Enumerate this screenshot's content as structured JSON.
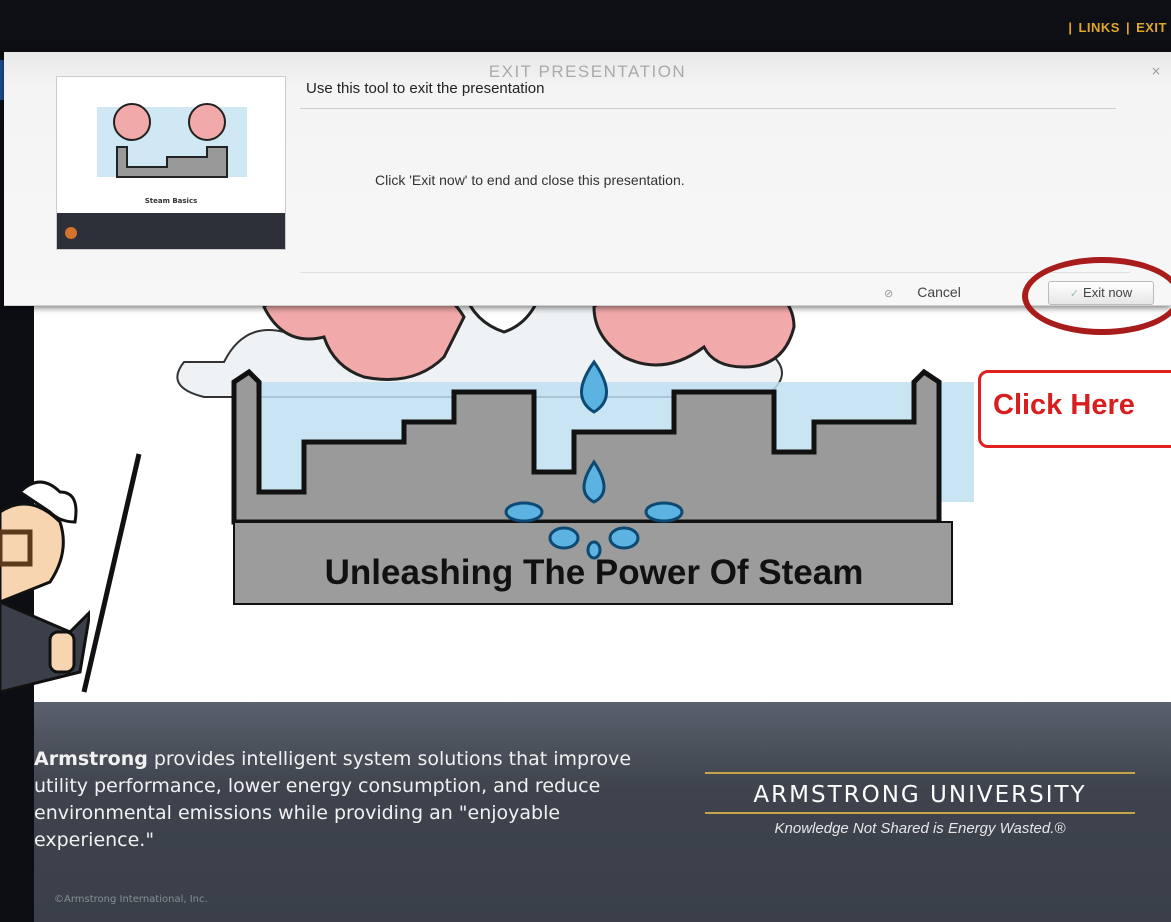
{
  "topbar": {
    "links_label": "LINKS",
    "exit_label": "EXIT"
  },
  "dialog": {
    "title": "EXIT PRESENTATION",
    "close_glyph": "×",
    "heading": "Use this tool to exit the presentation",
    "body": "Click 'Exit now' to end and close this presentation.",
    "cancel_label": "Cancel",
    "exit_label": "Exit now",
    "thumbnail_title": "Steam Basics"
  },
  "slide": {
    "banner": "Unleashing The Power Of Steam"
  },
  "callout": {
    "label": "Click Here"
  },
  "footer": {
    "brand": "Armstrong",
    "blurb": " provides intelligent system solutions that improve utility performance, lower energy consumption, and reduce environmental emissions while providing an \"enjoyable experience.\"",
    "university": "ARMSTRONG UNIVERSITY",
    "tagline": "Knowledge Not Shared is Energy Wasted.®",
    "copyright": "©Armstrong International, Inc."
  },
  "colors": {
    "accent": "#e0a72d",
    "callout_red": "#d81e1e",
    "ring_red": "#a91c1c",
    "footer_bg": "#3e434d"
  }
}
